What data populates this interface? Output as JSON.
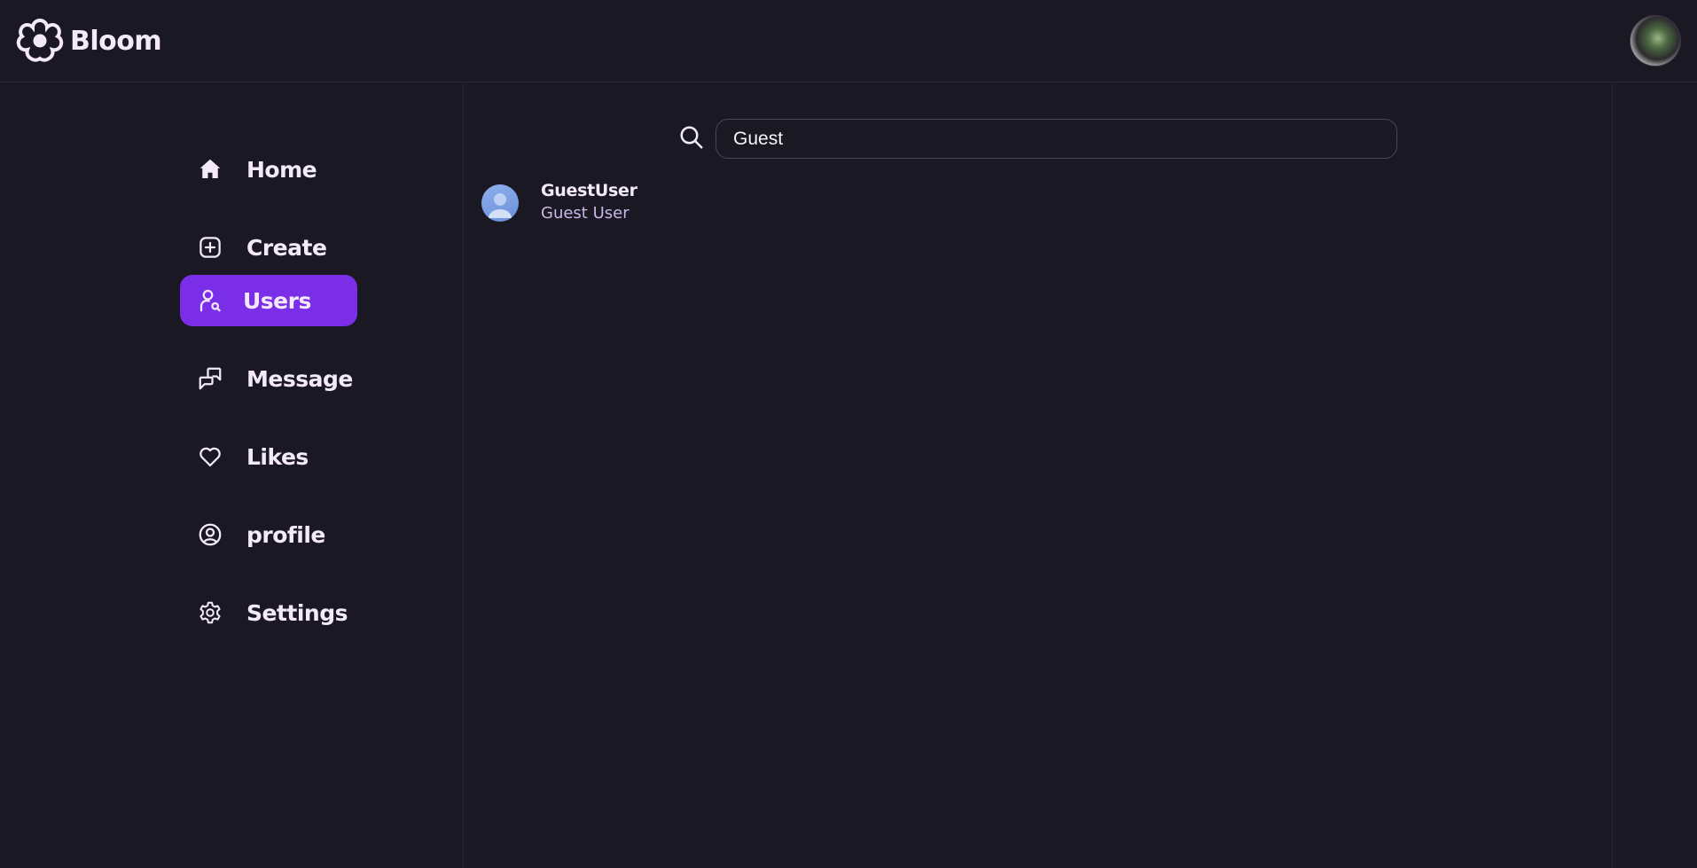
{
  "app": {
    "name": "Bloom"
  },
  "sidebar": {
    "items": [
      {
        "label": "Home",
        "icon": "home-icon",
        "active": false
      },
      {
        "label": "Create",
        "icon": "plus-square-icon",
        "active": false
      },
      {
        "label": "Users",
        "icon": "user-search-icon",
        "active": true
      },
      {
        "label": "Message",
        "icon": "chat-bubbles-icon",
        "active": false
      },
      {
        "label": "Likes",
        "icon": "heart-icon",
        "active": false
      },
      {
        "label": "profile",
        "icon": "user-circle-icon",
        "active": false
      },
      {
        "label": "Settings",
        "icon": "gear-icon",
        "active": false
      }
    ]
  },
  "search": {
    "value": "Guest",
    "icon": "search-icon"
  },
  "results": [
    {
      "username": "GuestUser",
      "full_name": "Guest User"
    }
  ],
  "colors": {
    "background": "#1a1823",
    "accent": "#7b2ee8",
    "text": "#f3e9fa",
    "muted": "#c9b8e6"
  }
}
